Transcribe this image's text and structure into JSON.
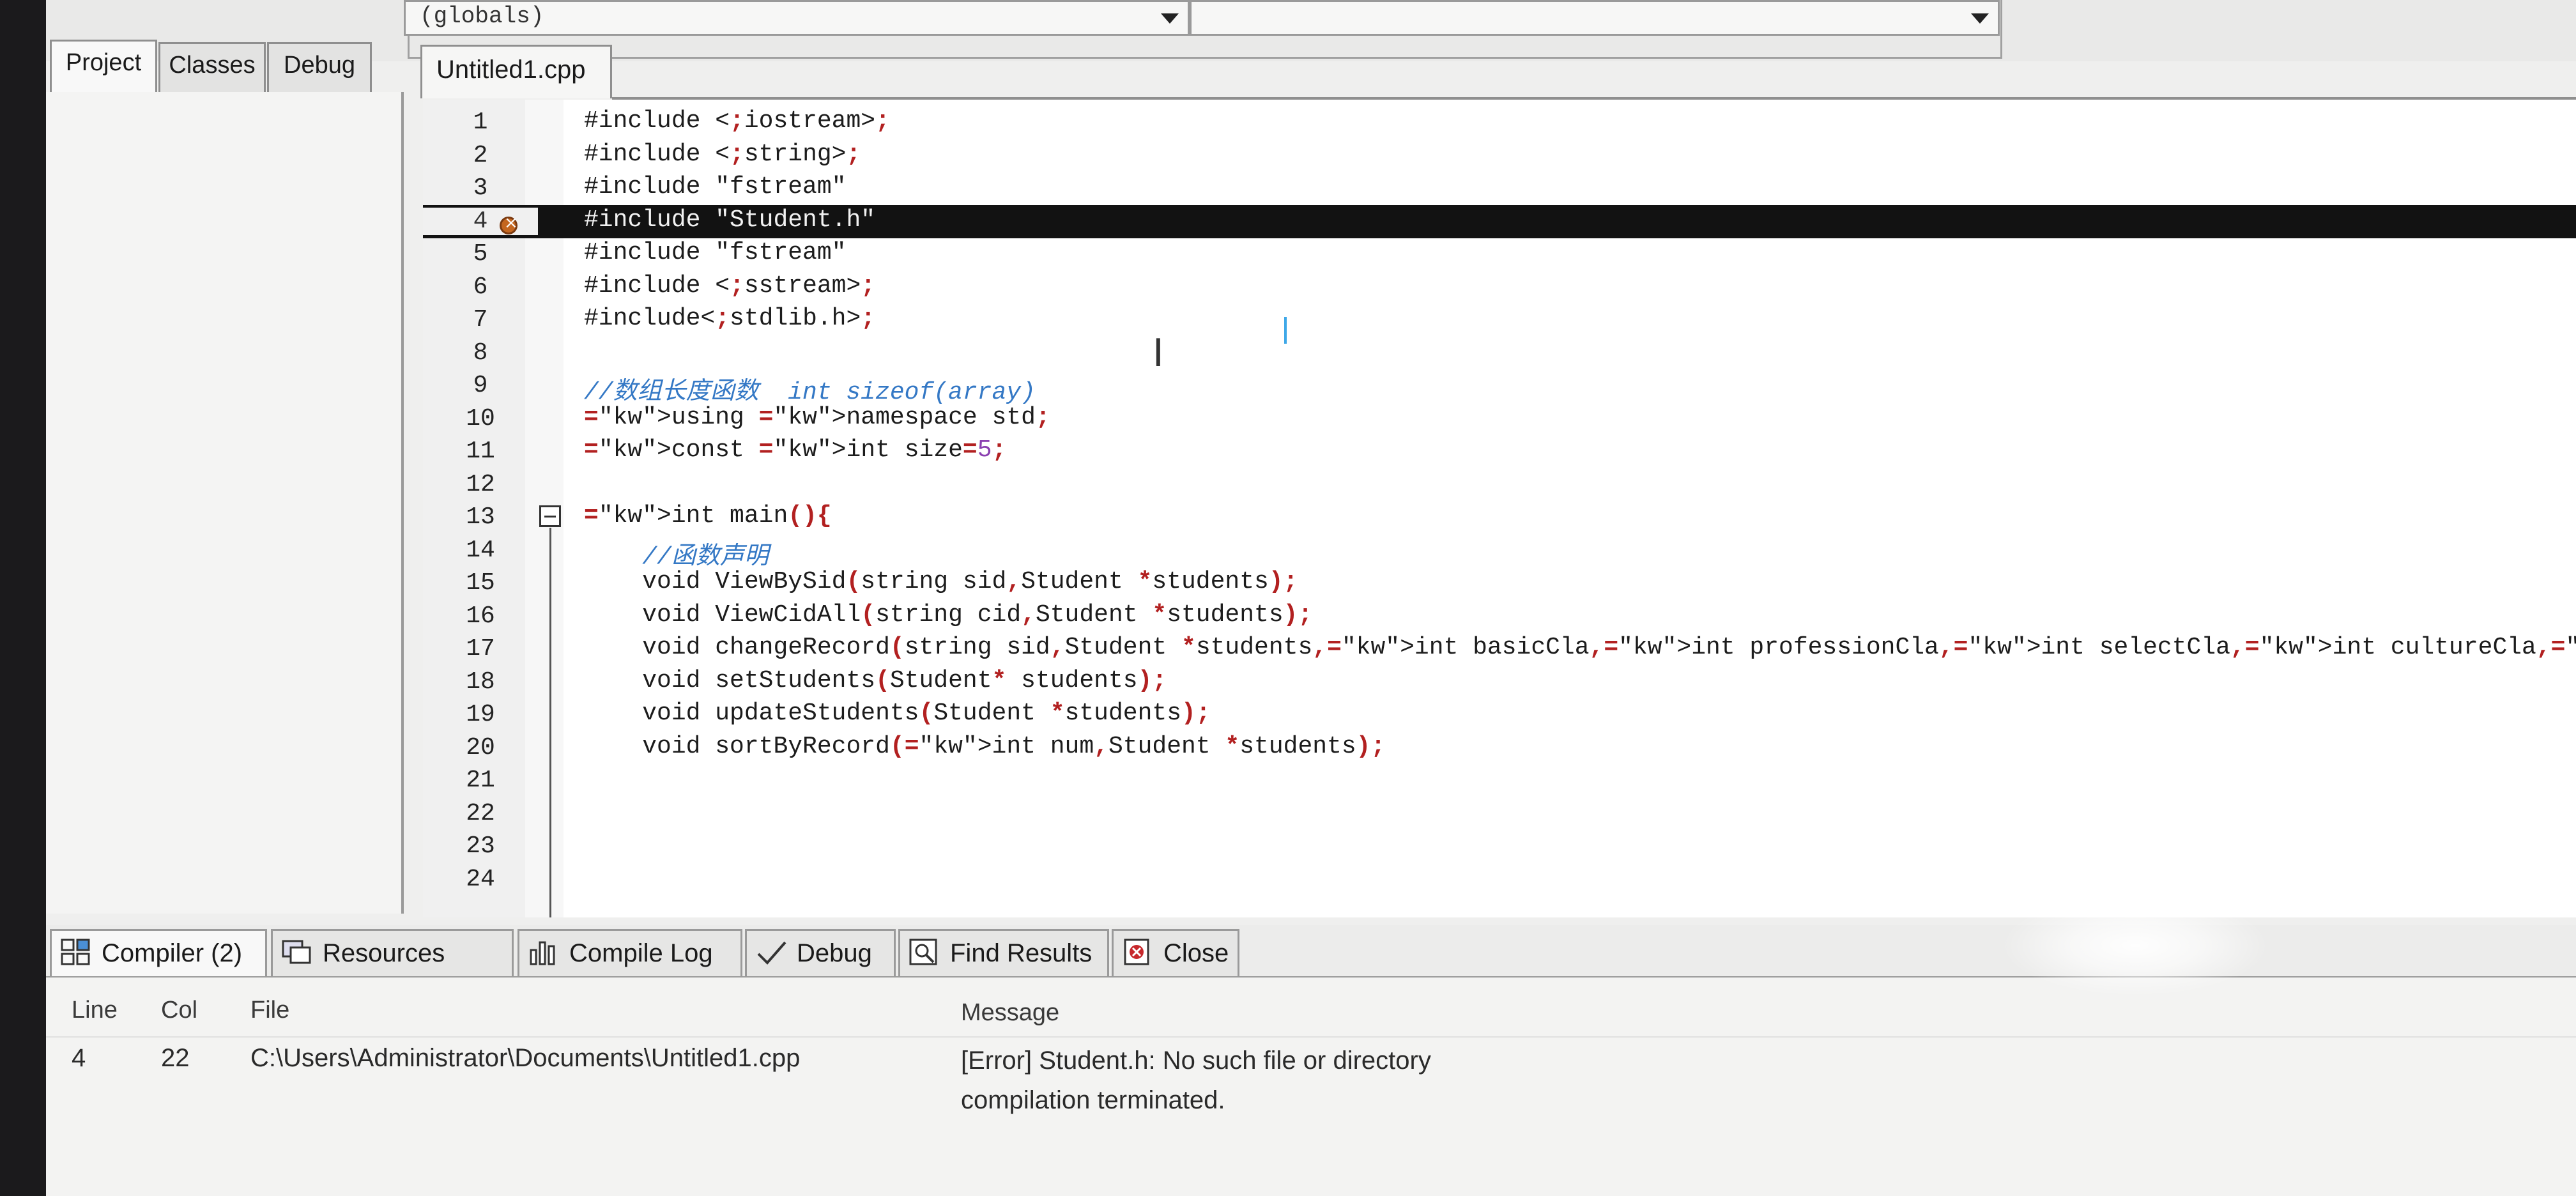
{
  "toolbar": {
    "scope_dropdown": "(globals)",
    "symbol_dropdown": ""
  },
  "left_tabs": [
    "Project",
    "Classes",
    "Debug"
  ],
  "editor_tab": "Untitled1.cpp",
  "editor": {
    "lines": [
      {
        "n": "1",
        "code": "#include <iostream>"
      },
      {
        "n": "2",
        "code": "#include <string>"
      },
      {
        "n": "3",
        "code": "#include \"fstream\""
      },
      {
        "n": "4",
        "code": "#include \"Student.h\""
      },
      {
        "n": "5",
        "code": "#include \"fstream\""
      },
      {
        "n": "6",
        "code": "#include <sstream>"
      },
      {
        "n": "7",
        "code": "#include<stdlib.h>"
      },
      {
        "n": "8",
        "code": ""
      },
      {
        "n": "9",
        "code": "//数组长度函数  int sizeof(array)"
      },
      {
        "n": "10",
        "code": "using namespace std;"
      },
      {
        "n": "11",
        "code": "const int size=5;"
      },
      {
        "n": "12",
        "code": ""
      },
      {
        "n": "13",
        "code": "int main(){"
      },
      {
        "n": "14",
        "code": "    //函数声明"
      },
      {
        "n": "15",
        "code": "    void ViewBySid(string sid,Student *students);"
      },
      {
        "n": "16",
        "code": "    void ViewCidAll(string cid,Student *students);"
      },
      {
        "n": "17",
        "code": "    void changeRecord(string sid,Student *students,int basicCla,int professionCla,int selectCla,int cultureCla,int practiceCla);"
      },
      {
        "n": "18",
        "code": "    void setStudents(Student* students);"
      },
      {
        "n": "19",
        "code": "    void updateStudents(Student *students);"
      },
      {
        "n": "20",
        "code": "    void sortByRecord(int num,Student *students);"
      },
      {
        "n": "21",
        "code": ""
      },
      {
        "n": "22",
        "code": ""
      },
      {
        "n": "23",
        "code": ""
      },
      {
        "n": "24",
        "code": ""
      }
    ],
    "error_line": "4"
  },
  "bottom_tabs": [
    {
      "label": "Compiler (2)",
      "icon": "grid-icon"
    },
    {
      "label": "Resources",
      "icon": "resources-icon"
    },
    {
      "label": "Compile Log",
      "icon": "bar-chart-icon"
    },
    {
      "label": "Debug",
      "icon": "check-icon"
    },
    {
      "label": "Find Results",
      "icon": "find-icon"
    },
    {
      "label": "Close",
      "icon": "close-icon"
    }
  ],
  "messages": {
    "headers": {
      "line": "Line",
      "col": "Col",
      "file": "File",
      "message": "Message"
    },
    "rows": [
      {
        "line": "4",
        "col": "22",
        "file": "C:\\Users\\Administrator\\Documents\\Untitled1.cpp",
        "message": "[Error] Student.h: No such file or directory"
      },
      {
        "line": "",
        "col": "",
        "file": "",
        "message": "compilation terminated."
      }
    ]
  },
  "colors": {
    "highlight_line": "#121212",
    "comment": "#3478c5",
    "punctuation": "#b22020",
    "error_marker": "#c4661f"
  }
}
